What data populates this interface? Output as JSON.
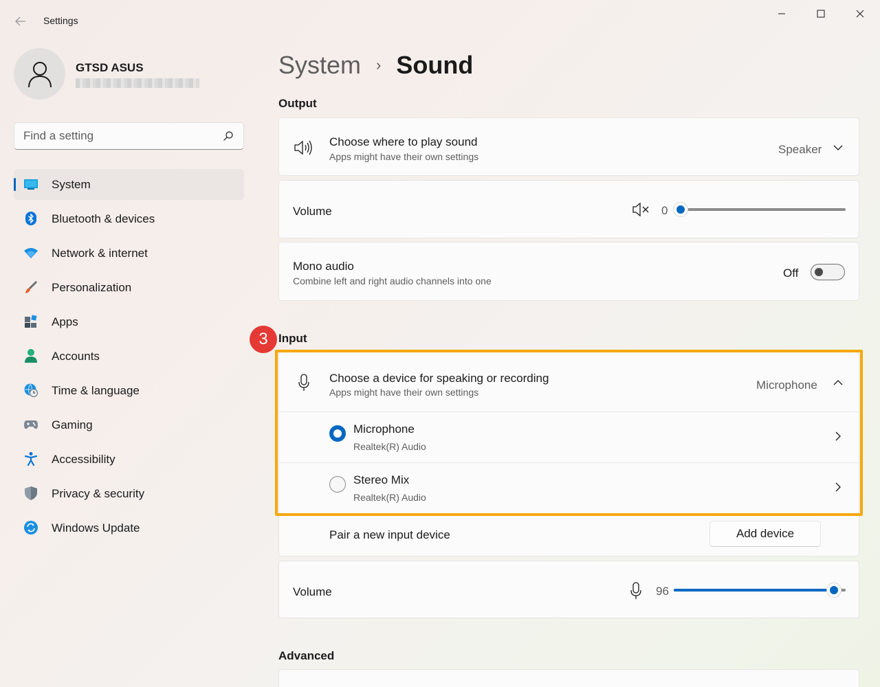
{
  "window": {
    "title": "Settings",
    "controls": {
      "minimize": "minimize-icon",
      "maximize": "maximize-icon",
      "close": "close-icon"
    }
  },
  "profile": {
    "name": "GTSD ASUS"
  },
  "search": {
    "placeholder": "Find a setting"
  },
  "sidebar": {
    "items": [
      {
        "label": "System",
        "icon": "system-icon",
        "active": true
      },
      {
        "label": "Bluetooth & devices",
        "icon": "bluetooth-icon"
      },
      {
        "label": "Network & internet",
        "icon": "wifi-icon"
      },
      {
        "label": "Personalization",
        "icon": "brush-icon"
      },
      {
        "label": "Apps",
        "icon": "apps-icon"
      },
      {
        "label": "Accounts",
        "icon": "accounts-icon"
      },
      {
        "label": "Time & language",
        "icon": "globe-clock-icon"
      },
      {
        "label": "Gaming",
        "icon": "gamepad-icon"
      },
      {
        "label": "Accessibility",
        "icon": "accessibility-icon"
      },
      {
        "label": "Privacy & security",
        "icon": "shield-icon"
      },
      {
        "label": "Windows Update",
        "icon": "update-icon"
      }
    ]
  },
  "breadcrumb": {
    "parent": "System",
    "separator": "›",
    "current": "Sound"
  },
  "output": {
    "heading": "Output",
    "device": {
      "title": "Choose where to play sound",
      "subtitle": "Apps might have their own settings",
      "value": "Speaker"
    },
    "volume": {
      "label": "Volume",
      "value": "0",
      "level": 0
    },
    "mono": {
      "title": "Mono audio",
      "subtitle": "Combine left and right audio channels into one",
      "state": "Off"
    }
  },
  "step_badge": "3",
  "input": {
    "heading": "Input",
    "device": {
      "title": "Choose a device for speaking or recording",
      "subtitle": "Apps might have their own settings",
      "value": "Microphone"
    },
    "options": [
      {
        "name": "Microphone",
        "driver": "Realtek(R) Audio",
        "selected": true
      },
      {
        "name": "Stereo Mix",
        "driver": "Realtek(R) Audio",
        "selected": false
      }
    ],
    "pair": {
      "label": "Pair a new input device",
      "button": "Add device"
    },
    "volume": {
      "label": "Volume",
      "value": "96",
      "level": 0.96
    }
  },
  "advanced": {
    "heading": "Advanced"
  },
  "colors": {
    "accent": "#0067c0",
    "highlight": "#f5a90f",
    "badge": "#e53935"
  }
}
